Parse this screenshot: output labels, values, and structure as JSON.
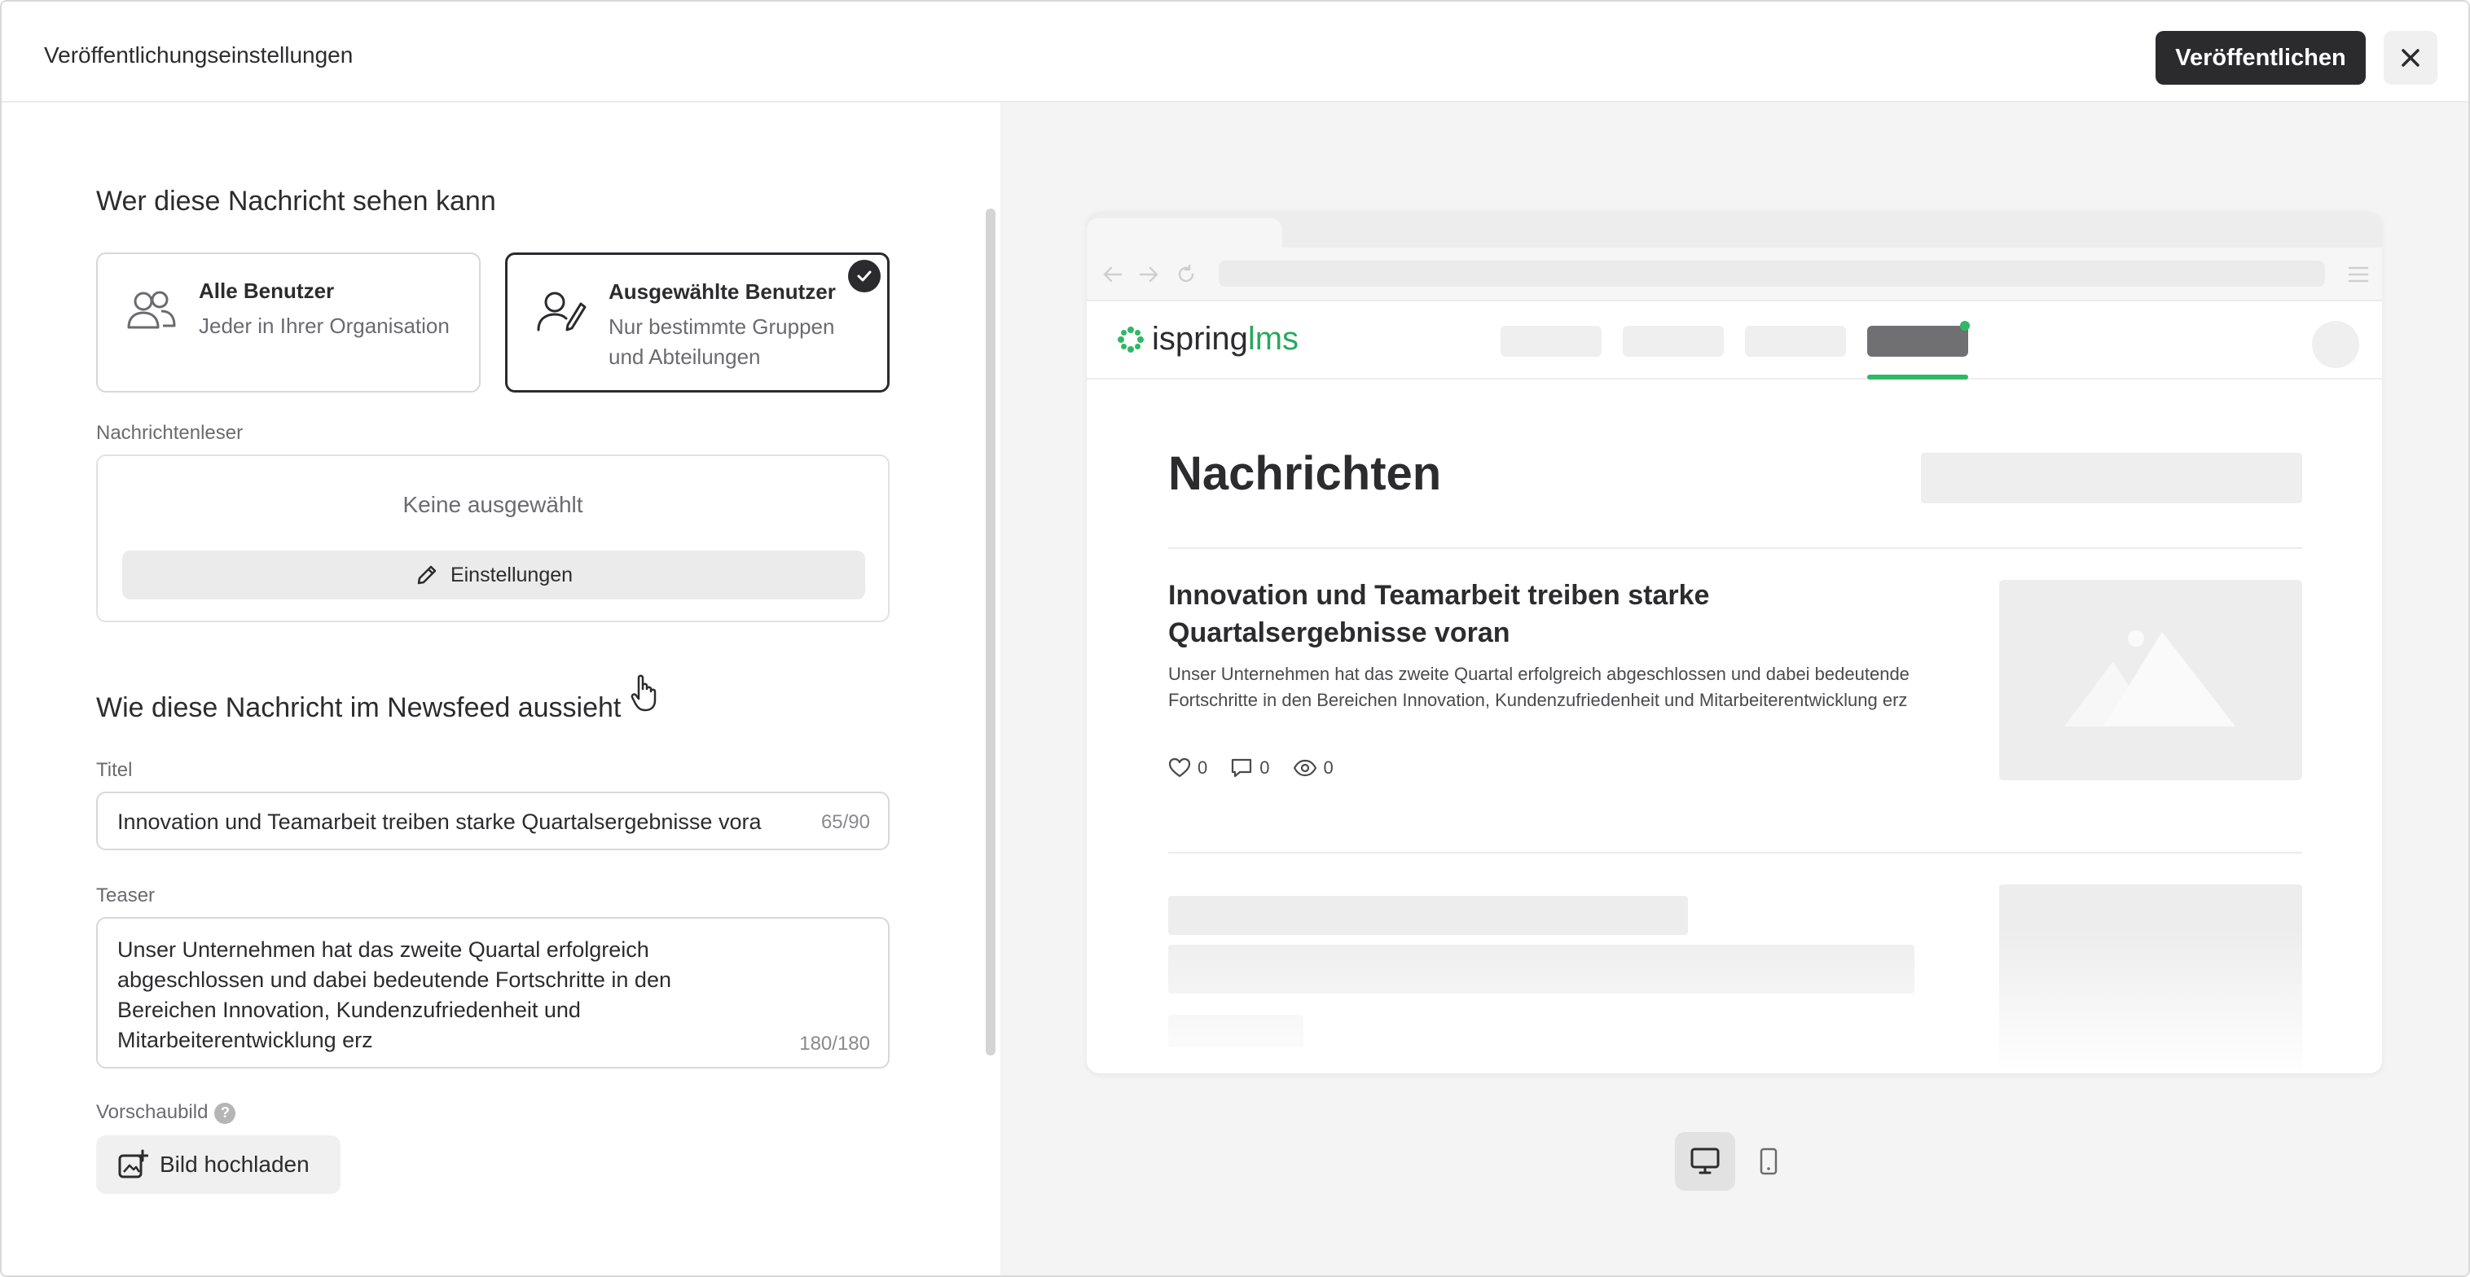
{
  "header": {
    "title": "Veröffentlichungseinstellungen",
    "publish_label": "Veröffentlichen"
  },
  "visibility": {
    "heading": "Wer diese Nachricht sehen kann",
    "options": [
      {
        "title": "Alle Benutzer",
        "description": "Jeder in Ihrer Organisation",
        "selected": false
      },
      {
        "title": "Ausgewählte Benutzer",
        "description": "Nur bestimmte Gruppen und Abteilungen",
        "selected": true
      }
    ]
  },
  "readers": {
    "label": "Nachrichtenleser",
    "empty_text": "Keine ausgewählt",
    "settings_label": "Einstellungen"
  },
  "newsfeed": {
    "heading": "Wie diese Nachricht im Newsfeed aussieht",
    "title_label": "Titel",
    "title_value": "Innovation und Teamarbeit treiben starke Quartalsergebnisse vora",
    "title_counter": "65/90",
    "teaser_label": "Teaser",
    "teaser_value": "Unser Unternehmen hat das zweite Quartal erfolgreich abgeschlossen und dabei bedeutende Fortschritte in den Bereichen Innovation, Kundenzufriedenheit und Mitarbeiterentwicklung erz",
    "teaser_counter": "180/180",
    "image_label": "Vorschaubild",
    "image_help": "?",
    "upload_label": "Bild hochladen"
  },
  "preview": {
    "logo_main": "ispring",
    "logo_accent": "lms",
    "page_title": "Nachrichten",
    "news_title": "Innovation und Teamarbeit treiben starke Quartalsergebnisse voran",
    "news_teaser": "Unser Unternehmen hat das zweite Quartal erfolgreich abgeschlossen und dabei bedeutende Fortschritte in den Bereichen Innovation, Kundenzufriedenheit und Mitarbeiterentwicklung erz",
    "likes": "0",
    "comments": "0",
    "views": "0",
    "accent_color": "#2fb865",
    "active_device": "desktop"
  }
}
